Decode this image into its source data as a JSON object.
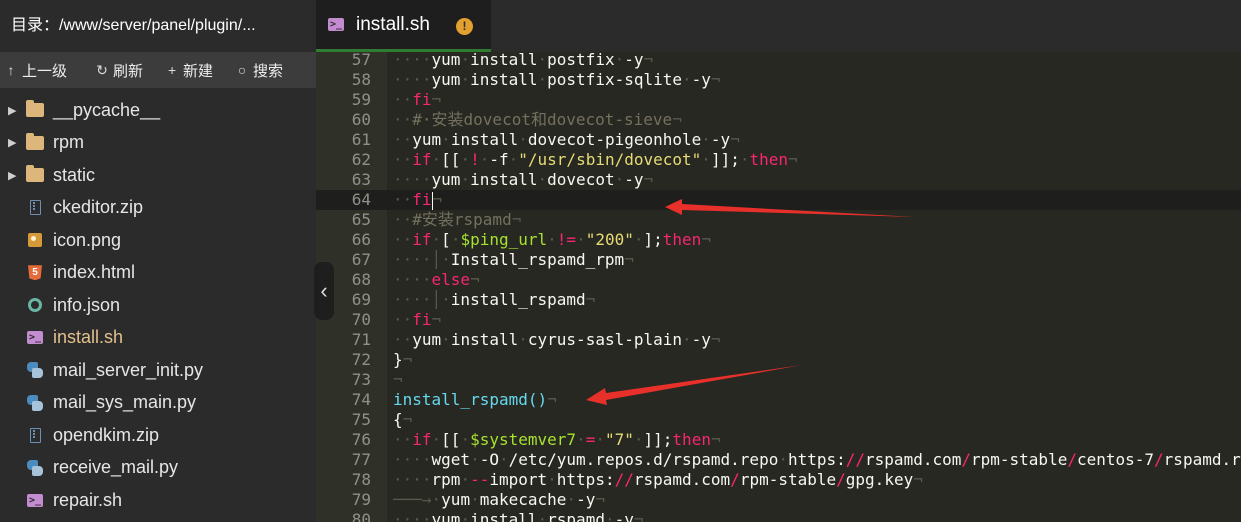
{
  "sidebar": {
    "header": "目录：/www/server/panel/plugin/...",
    "toolbar": {
      "up": "上一级",
      "refresh": "刷新",
      "new": "新建",
      "search": "搜索"
    },
    "files": [
      {
        "name": "__pycache__",
        "type": "folder"
      },
      {
        "name": "rpm",
        "type": "folder"
      },
      {
        "name": "static",
        "type": "folder"
      },
      {
        "name": "ckeditor.zip",
        "type": "zip"
      },
      {
        "name": "icon.png",
        "type": "image"
      },
      {
        "name": "index.html",
        "type": "html"
      },
      {
        "name": "info.json",
        "type": "json"
      },
      {
        "name": "install.sh",
        "type": "shell",
        "active": true
      },
      {
        "name": "mail_server_init.py",
        "type": "python"
      },
      {
        "name": "mail_sys_main.py",
        "type": "python"
      },
      {
        "name": "opendkim.zip",
        "type": "zip"
      },
      {
        "name": "receive_mail.py",
        "type": "python"
      },
      {
        "name": "repair.sh",
        "type": "shell"
      }
    ]
  },
  "tab": {
    "label": "install.sh",
    "badge": "!"
  },
  "editor": {
    "lines": [
      57,
      58,
      59,
      60,
      61,
      62,
      63,
      64,
      65,
      66,
      67,
      68,
      69,
      70,
      71,
      72,
      73,
      74,
      75,
      76,
      77,
      78,
      79,
      80
    ],
    "current_line": 64
  },
  "colors": {
    "accent": "#2f7d32",
    "warning": "#e3a02f",
    "active_file": "#e2c08d",
    "annotation_arrow": "#e8302a"
  }
}
